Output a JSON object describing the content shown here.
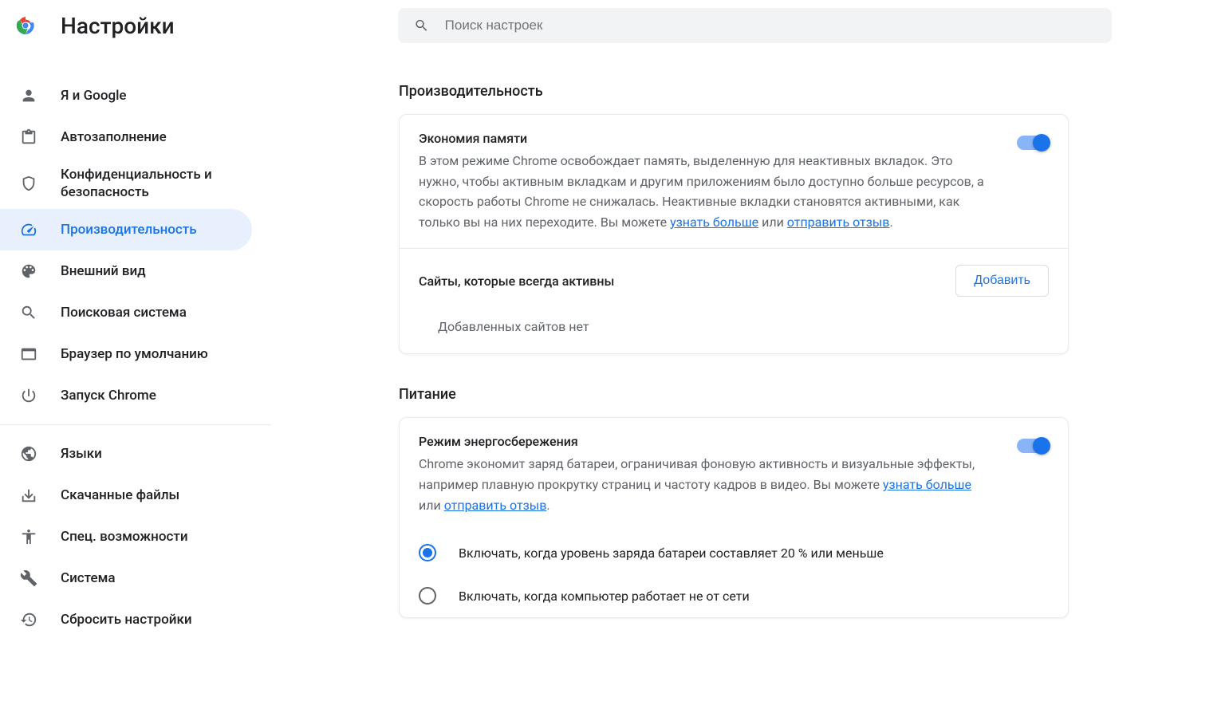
{
  "app": {
    "title": "Настройки"
  },
  "search": {
    "placeholder": "Поиск настроек"
  },
  "sidebar": {
    "items1": [
      {
        "label": "Я и Google"
      },
      {
        "label": "Автозаполнение"
      },
      {
        "label": "Конфиденциальность и безопасность"
      },
      {
        "label": "Производительность"
      },
      {
        "label": "Внешний вид"
      },
      {
        "label": "Поисковая система"
      },
      {
        "label": "Браузер по умолчанию"
      },
      {
        "label": "Запуск Chrome"
      }
    ],
    "items2": [
      {
        "label": "Языки"
      },
      {
        "label": "Скачанные файлы"
      },
      {
        "label": "Спец. возможности"
      },
      {
        "label": "Система"
      },
      {
        "label": "Сбросить настройки"
      }
    ]
  },
  "sections": {
    "performance": {
      "title": "Производительность",
      "memory": {
        "title": "Экономия памяти",
        "desc1": "В этом режиме Chrome освобождает память, выделенную для неактивных вкладок. Это нужно, чтобы активным вкладкам и другим приложениям было доступно больше ресурсов, а скорость работы Chrome не снижалась. Неактивные вкладки становятся активными, как только вы на них переходите. Вы можете ",
        "link1": "узнать больше",
        "bridge": " или ",
        "link2": "отправить отзыв",
        "tail": "."
      },
      "always_active": {
        "label": "Сайты, которые всегда активны",
        "button": "Добавить",
        "empty": "Добавленных сайтов нет"
      }
    },
    "power": {
      "title": "Питание",
      "saver": {
        "title": "Режим энергосбережения",
        "desc1": "Chrome экономит заряд батареи, ограничивая фоновую активность и визуальные эффекты, например плавную прокрутку страниц и частоту кадров в видео. Вы можете ",
        "link1": "узнать больше",
        "bridge": " или ",
        "link2": "отправить отзыв",
        "tail": "."
      },
      "radios": [
        {
          "label": "Включать, когда уровень заряда батареи составляет 20 % или меньше"
        },
        {
          "label": "Включать, когда компьютер работает не от сети"
        }
      ]
    }
  }
}
